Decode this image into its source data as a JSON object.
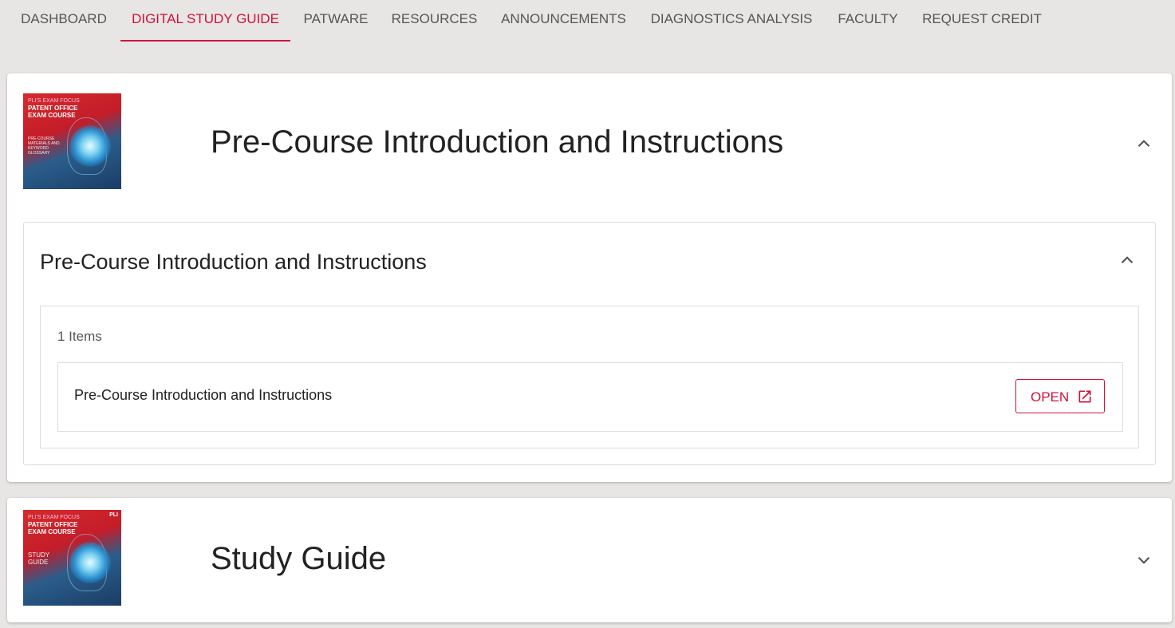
{
  "nav": {
    "items": [
      {
        "label": "DASHBOARD"
      },
      {
        "label": "DIGITAL STUDY GUIDE"
      },
      {
        "label": "PATWARE"
      },
      {
        "label": "RESOURCES"
      },
      {
        "label": "ANNOUNCEMENTS"
      },
      {
        "label": "DIAGNOSTICS ANALYSIS"
      },
      {
        "label": "FACULTY"
      },
      {
        "label": "REQUEST CREDIT"
      }
    ],
    "active_index": 1,
    "accent_color": "#d1103a"
  },
  "sections": [
    {
      "title": "Pre-Course Introduction and Instructions",
      "expanded": true,
      "cover": {
        "line1": "PLI'S EXAM FOCUS",
        "line2": "PATENT OFFICE",
        "line3": "EXAM COURSE",
        "sub": "PRE-COURSE MATERIALS AND KEYWORD GLOSSARY"
      },
      "chevron_icon": "chevron-up-icon",
      "subsection": {
        "title": "Pre-Course Introduction and Instructions",
        "chevron_icon": "chevron-up-icon",
        "items_count": "1 Items",
        "items": [
          {
            "label": "Pre-Course Introduction and Instructions",
            "button_label": "OPEN",
            "button_icon": "open-in-new-icon"
          }
        ]
      }
    },
    {
      "title": "Study Guide",
      "expanded": false,
      "cover": {
        "line1": "PLI'S EXAM FOCUS",
        "line2": "PATENT OFFICE",
        "line3": "EXAM COURSE",
        "sub": "STUDY GUIDE",
        "logo": "PLI"
      },
      "chevron_icon": "chevron-down-icon"
    }
  ]
}
